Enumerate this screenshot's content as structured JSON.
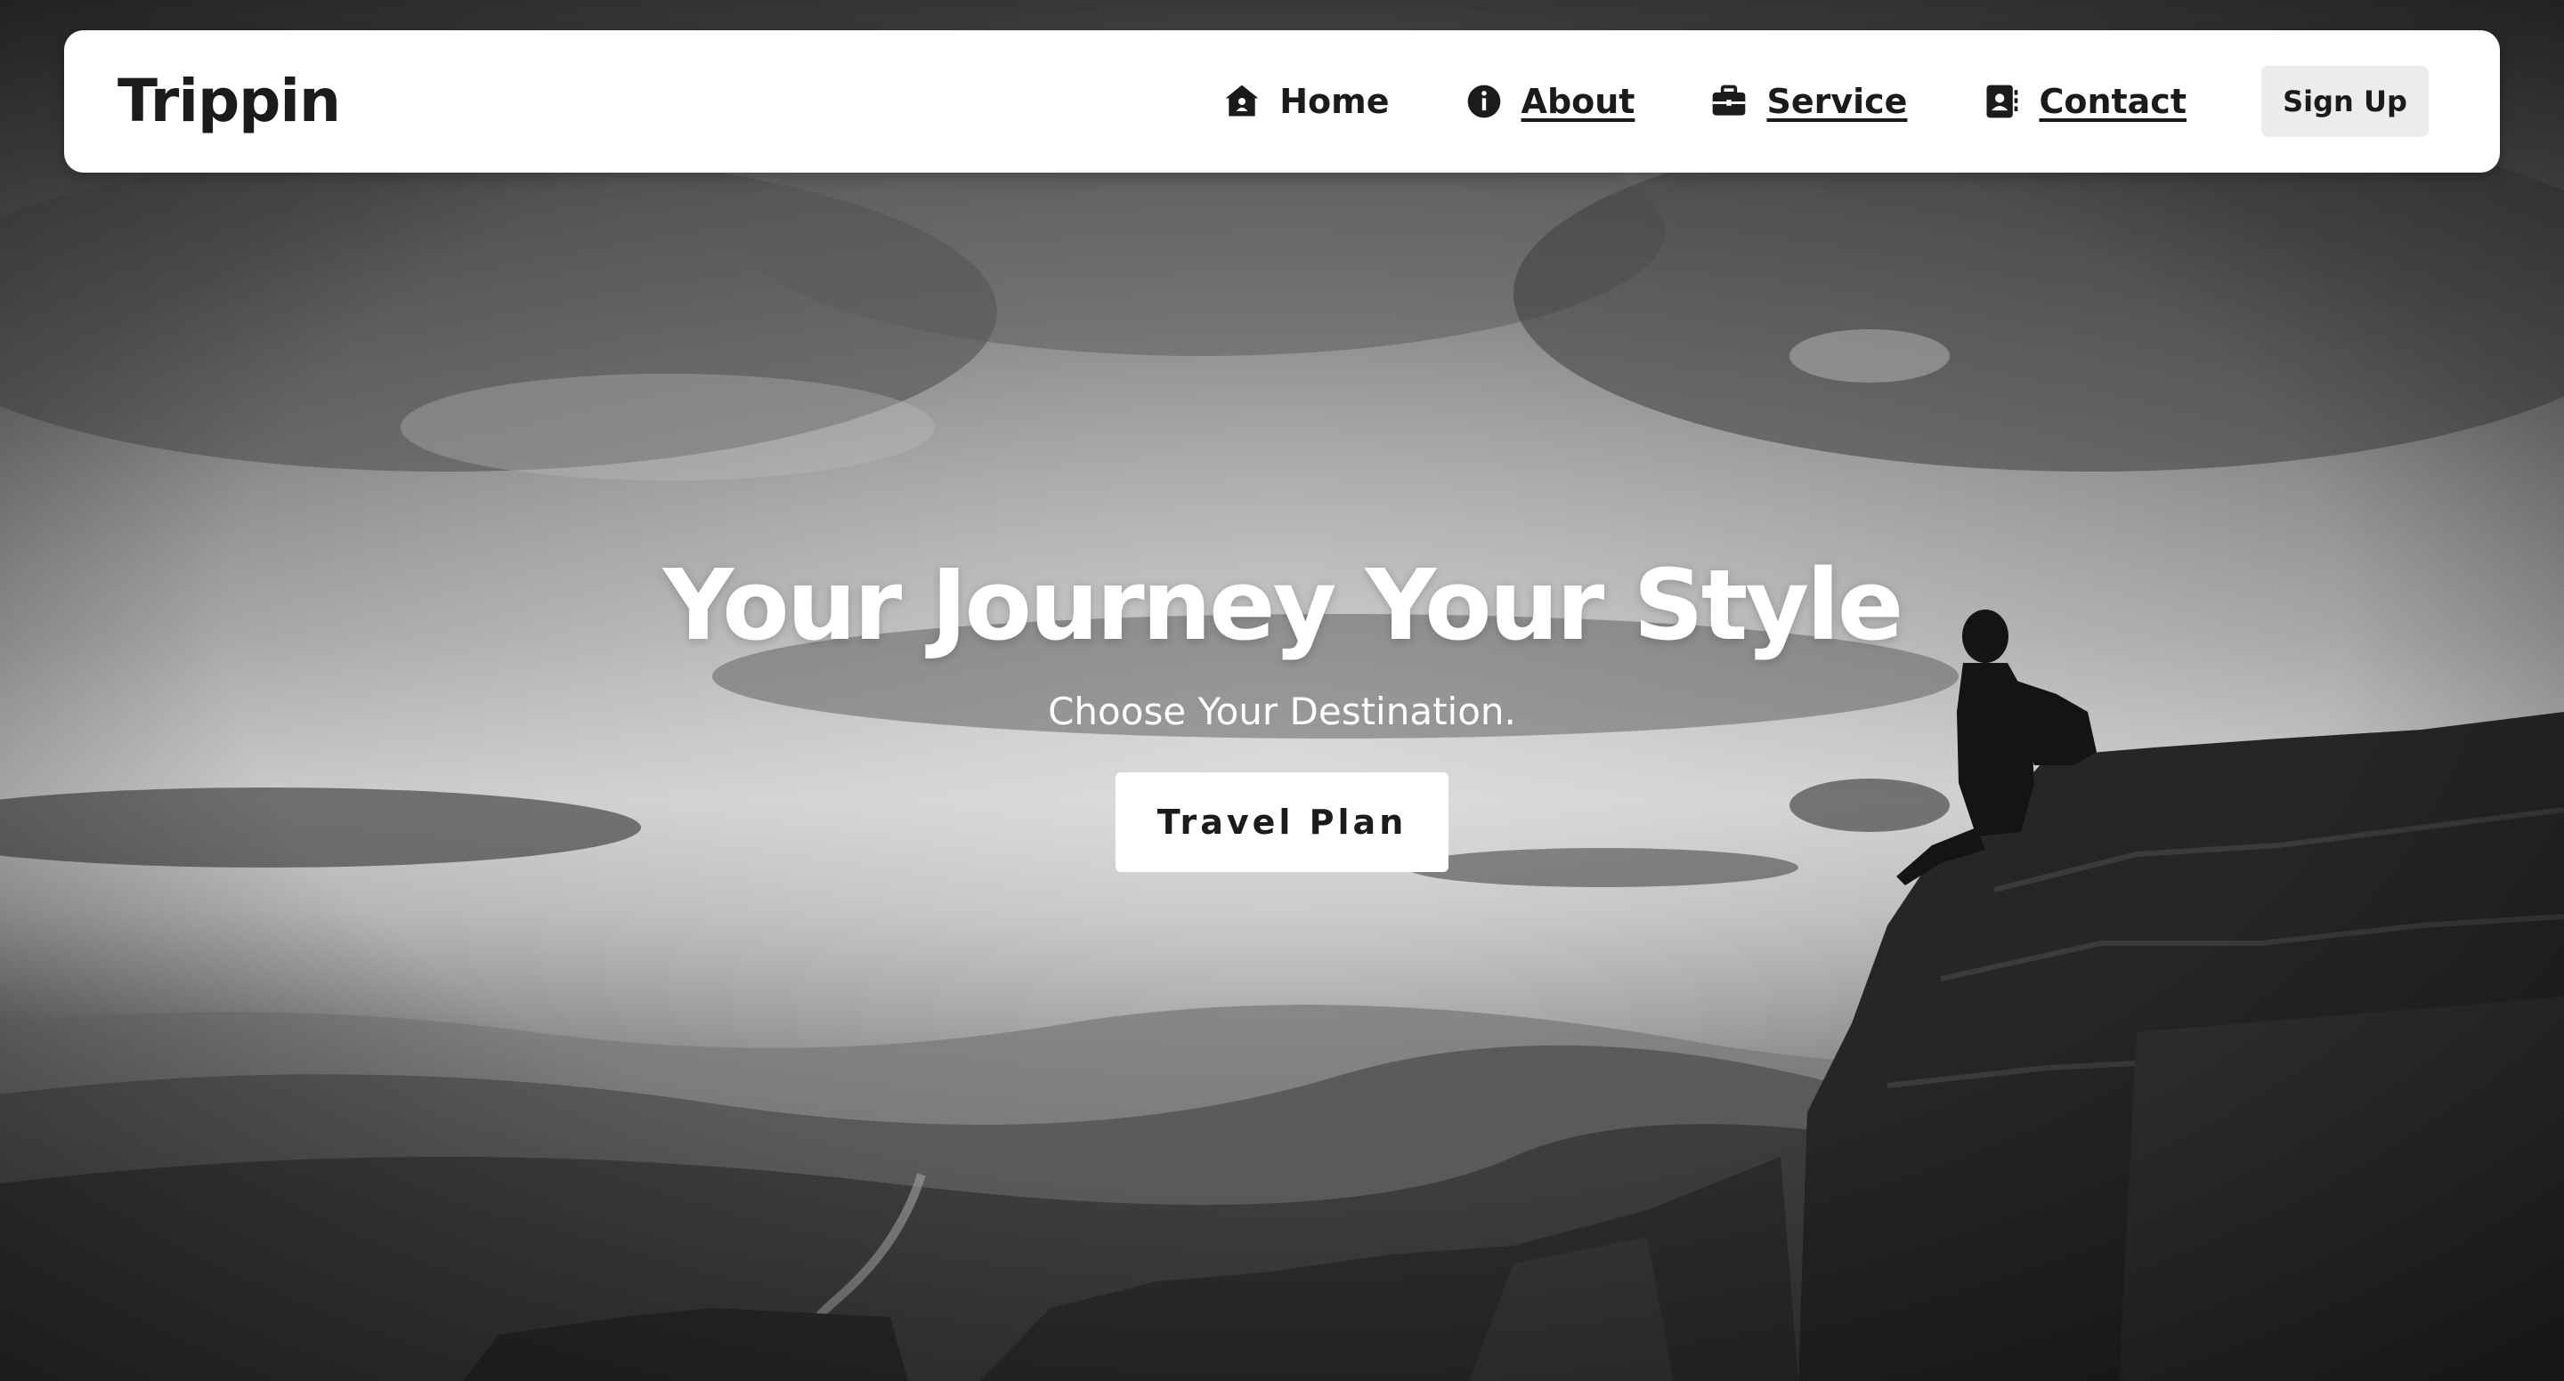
{
  "brand": {
    "name": "Trippin"
  },
  "nav": {
    "items": [
      {
        "label": "Home",
        "icon": "home-icon",
        "underlined": false
      },
      {
        "label": "About",
        "icon": "info-icon",
        "underlined": true
      },
      {
        "label": "Service",
        "icon": "briefcase-icon",
        "underlined": true
      },
      {
        "label": "Contact",
        "icon": "contact-book-icon",
        "underlined": true
      }
    ],
    "signup_label": "Sign Up"
  },
  "hero": {
    "title": "Your Journey Your Style",
    "subtitle": "Choose Your Destination.",
    "cta_label": "Travel Plan",
    "background": "black-and-white-mountain-hiker-photo"
  },
  "colors": {
    "navbar_bg": "#ffffff",
    "text_dark": "#1b1b1b",
    "signup_bg": "#ececec",
    "hero_text": "#ffffff"
  }
}
